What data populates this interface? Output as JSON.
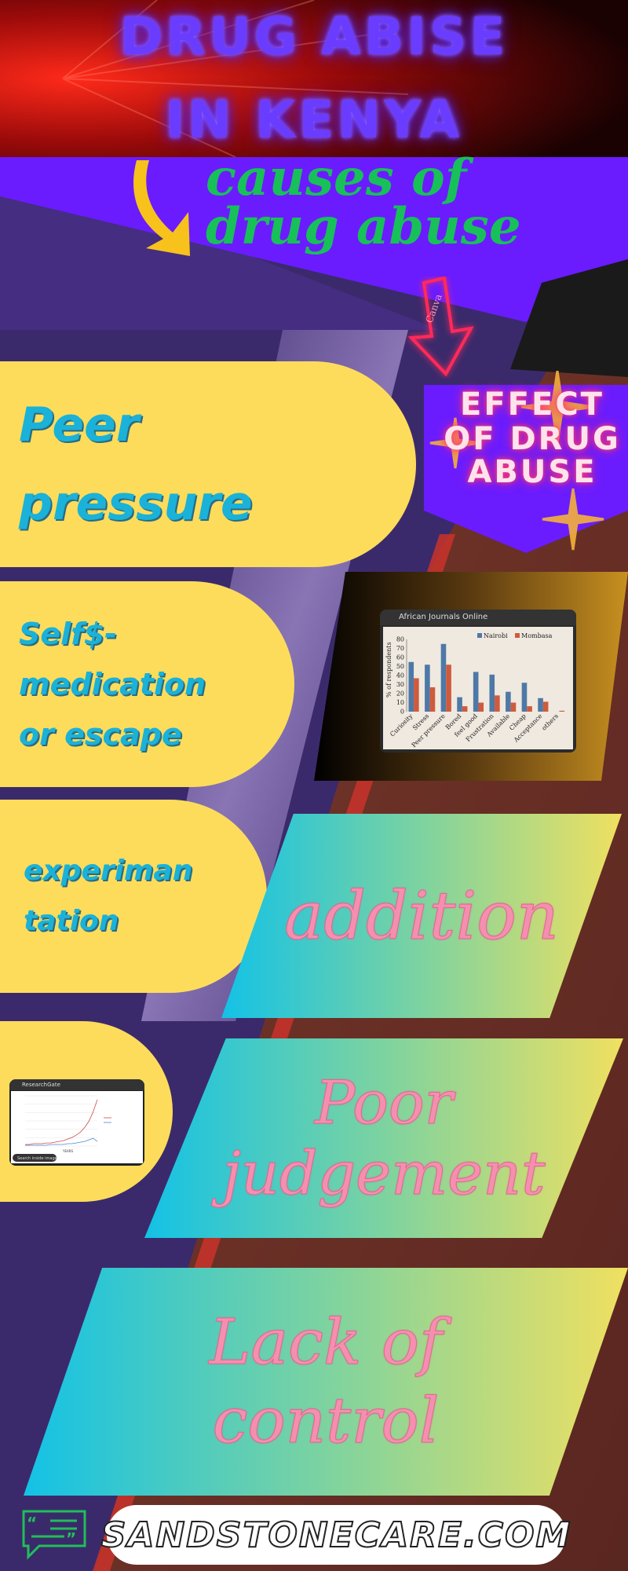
{
  "title": {
    "line1": "DRUG ABISE",
    "line2": "IN KENYA"
  },
  "causes_heading": {
    "line1": "causes of",
    "line2": "drug abuse"
  },
  "causes": [
    {
      "lines": [
        "Peer",
        "pressure"
      ]
    },
    {
      "lines": [
        "Self$-",
        "medication",
        "or escape"
      ]
    },
    {
      "lines": [
        "experiman",
        "tation"
      ]
    }
  ],
  "effect_badge": {
    "lines": [
      "EFFECT",
      "OF DRUG",
      "ABUSE"
    ],
    "mark": "Canva"
  },
  "bar_chart_card": {
    "source": "African Journals Online",
    "ylabel": "% of respondents",
    "legend": [
      "Nairobi",
      "Mombasa"
    ]
  },
  "line_chart_card": {
    "source": "ResearchGate",
    "xlabel": "YEARS",
    "search_label": "Search inside image"
  },
  "effects": [
    {
      "lines": [
        "addition"
      ]
    },
    {
      "lines": [
        "Poor",
        "judgement"
      ]
    },
    {
      "lines": [
        "Lack of",
        "control"
      ]
    }
  ],
  "footer": {
    "site": "SANDSTONECARE.COM"
  },
  "colors": {
    "title_glow": "#6a3cff",
    "heading_green": "#18c05a",
    "pill_yellow": "#fddc5c",
    "pill_text": "#1ab2d8",
    "effect_text": "#f58fb0",
    "banner_purple": "#6a1cff"
  },
  "icons": [
    "arrow-down-curved-icon",
    "neon-arrow-down-icon",
    "chat-bubble-icon"
  ],
  "chart_data": [
    {
      "type": "bar",
      "categories": [
        "Curiosity",
        "Stress",
        "Peer pressure",
        "Bored",
        "feel good",
        "Frustration",
        "Available",
        "Cheap",
        "Acceptance",
        "others"
      ],
      "series": [
        {
          "name": "Nairobi",
          "values": [
            55,
            52,
            75,
            16,
            44,
            41,
            22,
            32,
            15,
            0
          ],
          "color": "#4e79a7"
        },
        {
          "name": "Mombasa",
          "values": [
            37,
            27,
            52,
            6,
            10,
            18,
            10,
            6,
            11,
            1
          ],
          "color": "#d05a3c"
        }
      ],
      "ylabel": "% of respondents",
      "ylim": [
        0,
        80
      ],
      "yticks": [
        0,
        10,
        20,
        30,
        40,
        50,
        60,
        70,
        80
      ],
      "grid": false,
      "legend": "top-right"
    },
    {
      "type": "line",
      "x": [
        1,
        2,
        3,
        4,
        5,
        6,
        7,
        8,
        9,
        10,
        11,
        12,
        13,
        14,
        15,
        16,
        17,
        18
      ],
      "series": [
        {
          "values": [
            2,
            2,
            3,
            3,
            3,
            4,
            4,
            5,
            6,
            7,
            9,
            11,
            14,
            18,
            24,
            32,
            44,
            60
          ],
          "color": "#d04a4a"
        },
        {
          "values": [
            1,
            1,
            1,
            1,
            1,
            1,
            2,
            2,
            2,
            2,
            3,
            3,
            4,
            5,
            6,
            8,
            10,
            6
          ],
          "color": "#4a8ad0"
        }
      ],
      "xlabel": "YEARS",
      "ylim": [
        0,
        65
      ],
      "grid": true,
      "legend": "right"
    }
  ]
}
